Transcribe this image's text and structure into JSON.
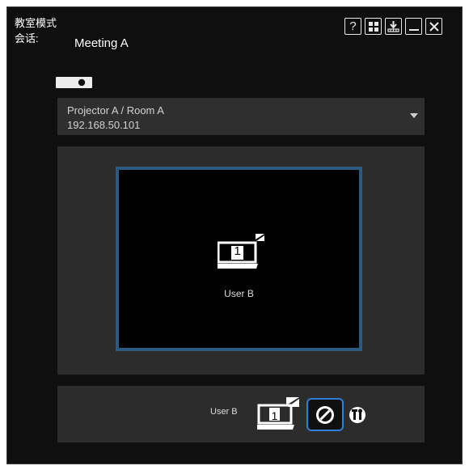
{
  "window": {
    "mode_title": "教室模式",
    "session_label": "会话:",
    "session_name": "Meeting A",
    "toolbar": [
      {
        "icon": "help-icon",
        "label": "?"
      },
      {
        "icon": "grid-icon",
        "label": ""
      },
      {
        "icon": "download-icon",
        "label": ""
      },
      {
        "icon": "minimize-icon",
        "label": ""
      },
      {
        "icon": "close-icon",
        "label": ""
      }
    ]
  },
  "projector": {
    "icon": "projector-icon",
    "name": "Projector A / Room A",
    "ip": "192.168.50.101"
  },
  "screen": {
    "slot_number": "1",
    "user": "User B"
  },
  "user_row": {
    "user": "User B",
    "slot_number": "1",
    "icons": [
      "computer-icon",
      "block-icon",
      "tools-icon"
    ]
  },
  "colors": {
    "background": "#0f0f0f",
    "panel": "#2c2c2c",
    "screen_border": "#2c5a80",
    "highlight": "#2f7ed8"
  }
}
